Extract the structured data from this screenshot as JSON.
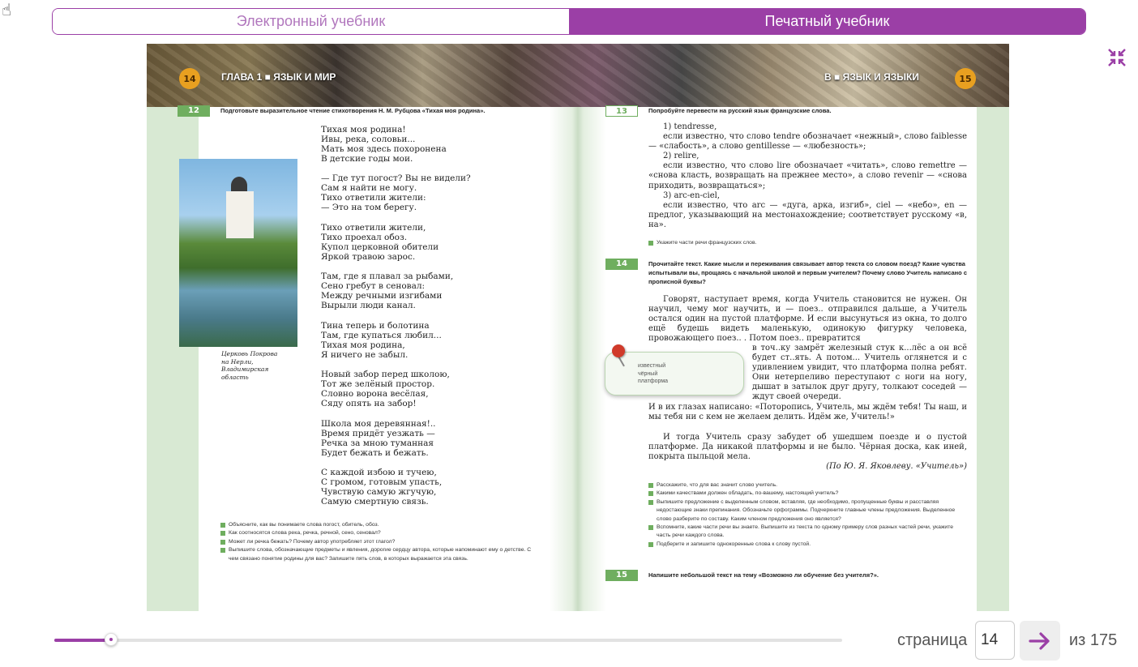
{
  "tabs": {
    "electronic": "Электронный учебник",
    "printed": "Печатный учебник",
    "active": "printed"
  },
  "icons": {
    "fullscreen": "collapse-arrows-icon",
    "next": "arrow-right-icon",
    "cursor": "hand-cursor-icon"
  },
  "colors": {
    "accent": "#9b3fa6",
    "green": "#6fae5f",
    "page_badge": "#e8a020"
  },
  "left_page": {
    "number": "14",
    "chapter": "ГЛАВА 1 ■ ЯЗЫК И МИР",
    "exercise_num": "12",
    "task": "Подготовьте выразительное чтение стихотворения Н. М. Рубцова «Тихая моя родина».",
    "poem": [
      "Тихая моя родина!\nИвы, река, соловьи...\nМать моя здесь похоронена\nВ детские годы мои.",
      "— Где тут погост? Вы не видели?\nСам я найти не могу.\nТихо ответили жители:\n— Это на том берегу.",
      "Тихо ответили жители,\nТихо проехал обоз.\nКупол церковной обители\nЯркой травою зарос.",
      "Там, где я плавал за рыбами,\nСено гребут в сеновал:\nМежду речными изгибами\nВырыли люди канал.",
      "Тина теперь и болотина\nТам, где купаться любил...\nТихая моя родина,\nЯ ничего не забыл.",
      "Новый забор перед школою,\nТот же зелёный простор.\nСловно ворона весёлая,\nСяду опять на забор!",
      "Школа моя деревянная!..\nВремя придёт уезжать —\nРечка за мною туманная\nБудет бежать и бежать.",
      "С каждой избою и тучею,\nС громом, готовым упасть,\nЧувствую самую жгучую,\nСамую смертную связь."
    ],
    "caption": "Церковь Покрова\nна Нерли,\nВладимирская\nобласть",
    "questions": [
      "Объясните, как вы понимаете слова погост, обитель, обоз.",
      "Как соотносятся слова река, речка, речной, сено, сеновал?",
      "Может ли речка бежать? Почему автор употребляет этот глагол?",
      "Выпишите слова, обозначающие предметы и явления, дорогие сердцу автора, которые напоминают ему о детстве. С чем связано понятие родины для вас? Запишите пять слов, в которых выражается эта связь."
    ]
  },
  "right_page": {
    "number": "15",
    "chapter": "В ■ ЯЗЫК И ЯЗЫКИ",
    "ex13": {
      "num": "13",
      "task": "Попробуйте перевести на русский язык французские слова.",
      "items": [
        "1) tendresse,",
        "если известно, что слово tendre обозначает «нежный», слово faiblesse — «слабость», а слово gentillesse — «любезность»;",
        "2) relire,",
        "если известно, что слово lire обозначает «читать», слово remettre — «снова класть, возвращать на прежнее место», а слово revenir — «снова приходить, возвращаться»;",
        "3) arc-en-ciel,",
        "если известно, что arc — «дуга, арка, изгиб», ciel — «небо», en — предлог, указывающий на местонахождение; соответствует русскому «в, на»."
      ],
      "question": "Укажите части речи французских слов."
    },
    "ex14": {
      "num": "14",
      "task": "Прочитайте текст. Какие мысли и переживания связывает автор текста со словом поезд? Какие чувства испытывали вы, прощаясь с начальной школой и первым учителем? Почему слово Учитель написано с прописной буквы?",
      "text_p1": "Говорят, наступает время, когда Учитель становится не нужен. Он научил, чему мог научить, и — поез.. отправился дальше, а Учитель остался один на пустой платформе. И если высунуться из окна, то долго ещё будешь видеть маленькую, одинокую фигурку человека, провожающего поез.. . Потом поез.. превратится",
      "text_wrap": "в точ..ку замрёт железный стук к...лёс а он всё будет ст..ять. А потом... Учитель оглянется и с удивлением увидит, что платформа полна ребят. Они нетерпеливо переступают с ноги на ногу, дышат в затылок друг другу, толкают соседей — ждут своей очереди.",
      "text_p1_end": "И в их глазах написано: «Поторопись, Учитель, мы ждём тебя! Ты наш, и мы тебя ни с кем не желаем делить. Идём же, Учитель!»",
      "text_p2": "И тогда Учитель сразу забудет об ушедшем поезде и о пустой платформе. Да никакой платформы и не было. Чёрная доска, как иней, покрыта пыльцой мела.",
      "source": "(По Ю. Я. Яковлеву. «Учитель»)",
      "note": "известный\nчёрный\nплатформа",
      "questions": [
        "Расскажите, что для вас значит слово учитель.",
        "Какими качествами должен обладать, по-вашему, настоящий учитель?",
        "Выпишите предложение с выделенным словом, вставляя, где необходимо, пропущенные буквы и расставляя недостающие знаки препинания. Обозначьте орфограммы. Подчеркните главные члены предложения. Выделенное слово разберите по составу. Каким членом предложения оно является?",
        "Вспомните, какие части речи вы знаете. Выпишите из текста по одному примеру слов разных частей речи, укажите часть речи каждого слова.",
        "Подберите и запишите однокоренные слова к слову пустой."
      ]
    },
    "ex15": {
      "num": "15",
      "task": "Напишите небольшой текст на тему «Возможно ли обучение без учителя?»."
    }
  },
  "pager": {
    "label": "страница",
    "current": "14",
    "total_label": "из 175",
    "progress_fraction": 0.072
  }
}
